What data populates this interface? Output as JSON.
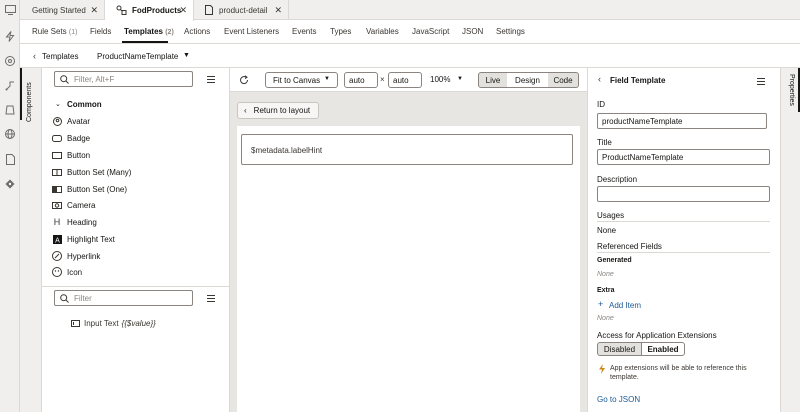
{
  "tabs": [
    {
      "label": "Getting Started"
    },
    {
      "label": "FodProducts"
    },
    {
      "label": "product-detail"
    }
  ],
  "subtabs": {
    "rule_sets": "Rule Sets",
    "rule_sets_count": "(1)",
    "fields": "Fields",
    "templates": "Templates",
    "templates_count": "(2)",
    "actions": "Actions",
    "event_listeners": "Event Listeners",
    "events": "Events",
    "types": "Types",
    "variables": "Variables",
    "javascript": "JavaScript",
    "json": "JSON",
    "settings": "Settings"
  },
  "breadcrumb": {
    "back": "Templates",
    "current": "ProductNameTemplate"
  },
  "left": {
    "strip_label": "Components",
    "filter_placeholder": "Filter, Alt+F",
    "section": "Common",
    "components": [
      {
        "label": "Avatar",
        "icon": "avatar-icon"
      },
      {
        "label": "Badge",
        "icon": "badge-icon"
      },
      {
        "label": "Button",
        "icon": "button-icon"
      },
      {
        "label": "Button Set (Many)",
        "icon": "button-set-icon"
      },
      {
        "label": "Button Set (One)",
        "icon": "button-set-icon"
      },
      {
        "label": "Camera",
        "icon": "camera-icon"
      },
      {
        "label": "Heading",
        "icon": "heading-icon"
      },
      {
        "label": "Highlight Text",
        "icon": "highlight-text-icon"
      },
      {
        "label": "Hyperlink",
        "icon": "hyperlink-icon"
      },
      {
        "label": "Icon",
        "icon": "icon-icon"
      }
    ],
    "structure_filter_placeholder": "Filter",
    "tree_item_label": "Input Text",
    "tree_item_value": "{{$value}}"
  },
  "toolbar": {
    "fit": "Fit to Canvas",
    "width": "auto",
    "times": "×",
    "height": "auto",
    "zoom": "100%",
    "live": "Live",
    "design": "Design",
    "code": "Code"
  },
  "canvas": {
    "return": "Return to layout",
    "field_text": "$metadata.labelHint"
  },
  "right": {
    "header": "Field Template",
    "id_label": "ID",
    "id_value": "productNameTemplate",
    "title_label": "Title",
    "title_value": "ProductNameTemplate",
    "description_label": "Description",
    "description_value": "",
    "usages_label": "Usages",
    "usages_value": "None",
    "referenced_label": "Referenced Fields",
    "generated_label": "Generated",
    "generated_value": "None",
    "extra_label": "Extra",
    "add_item": "Add Item",
    "extra_value": "None",
    "access_label": "Access for Application Extensions",
    "disabled": "Disabled",
    "enabled": "Enabled",
    "info_line1": "App extensions will be able to reference this",
    "info_line2": "template.",
    "goto_json": "Go to JSON",
    "strip_label": "Properties"
  },
  "colors": {
    "link": "#1b5a96",
    "info": "#c98a1a",
    "segment_active": "#e3e1de"
  }
}
